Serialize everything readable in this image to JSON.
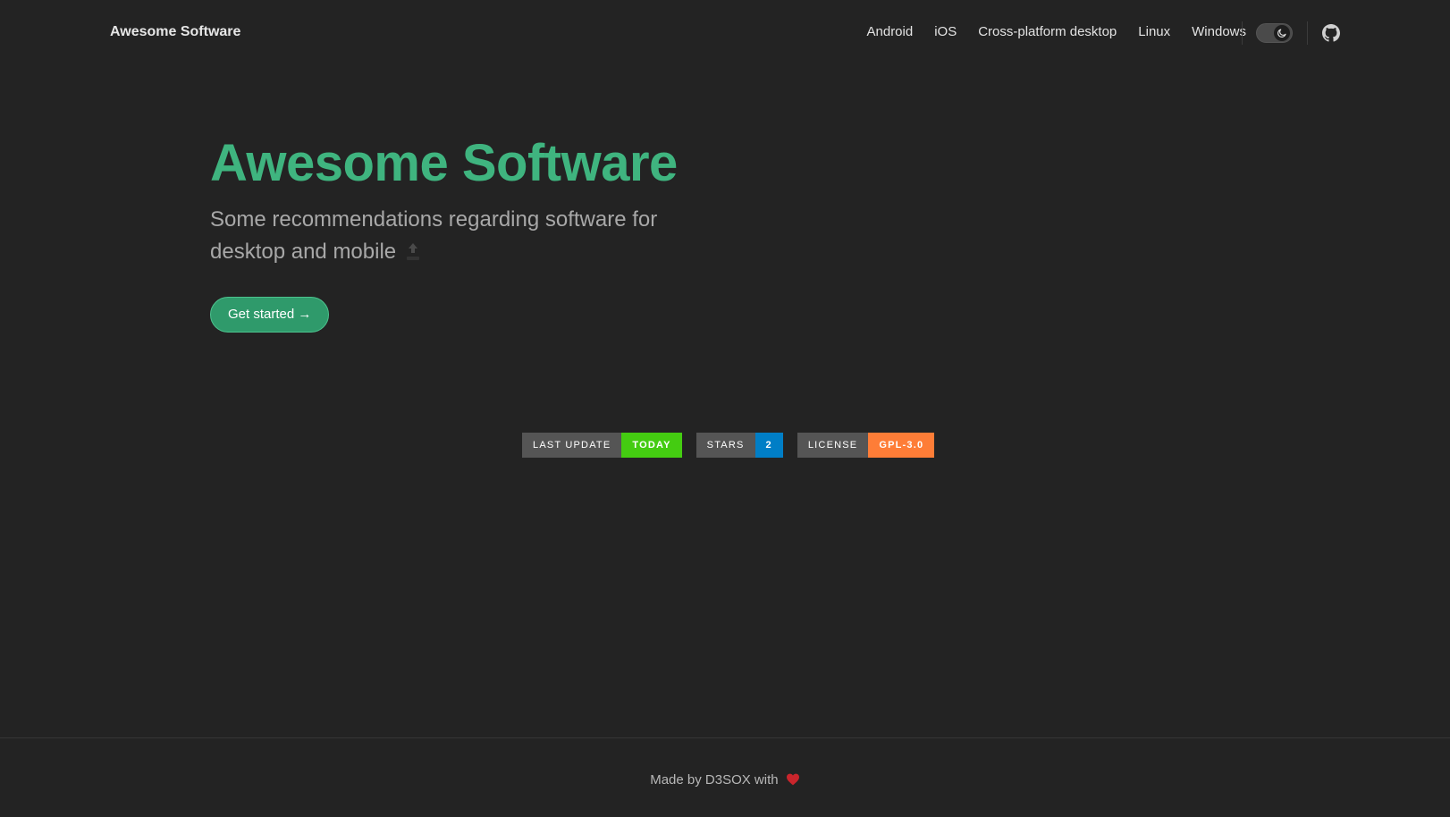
{
  "header": {
    "brand": "Awesome Software",
    "nav": [
      {
        "label": "Android"
      },
      {
        "label": "iOS"
      },
      {
        "label": "Cross-platform desktop"
      },
      {
        "label": "Linux"
      },
      {
        "label": "Windows"
      }
    ],
    "theme_toggle": {
      "icon": "moon-icon",
      "state": "dark"
    },
    "github_icon": "github-icon"
  },
  "hero": {
    "title": "Awesome Software",
    "tagline": "Some recommendations regarding software for desktop and mobile",
    "tagline_icon": "top-arrow-icon",
    "cta_label": "Get started →"
  },
  "badges": [
    {
      "label": "LAST UPDATE",
      "value": "TODAY",
      "color": "#44cc11"
    },
    {
      "label": "STARS",
      "value": "2",
      "color": "#007ec6"
    },
    {
      "label": "LICENSE",
      "value": "GPL-3.0",
      "color": "#fe7d37"
    }
  ],
  "footer": {
    "text": "Made by D3SOX with",
    "heart_icon": "heart-icon"
  },
  "colors": {
    "background": "#232323",
    "accent": "#3fb47f",
    "button": "#2f9a6b"
  }
}
